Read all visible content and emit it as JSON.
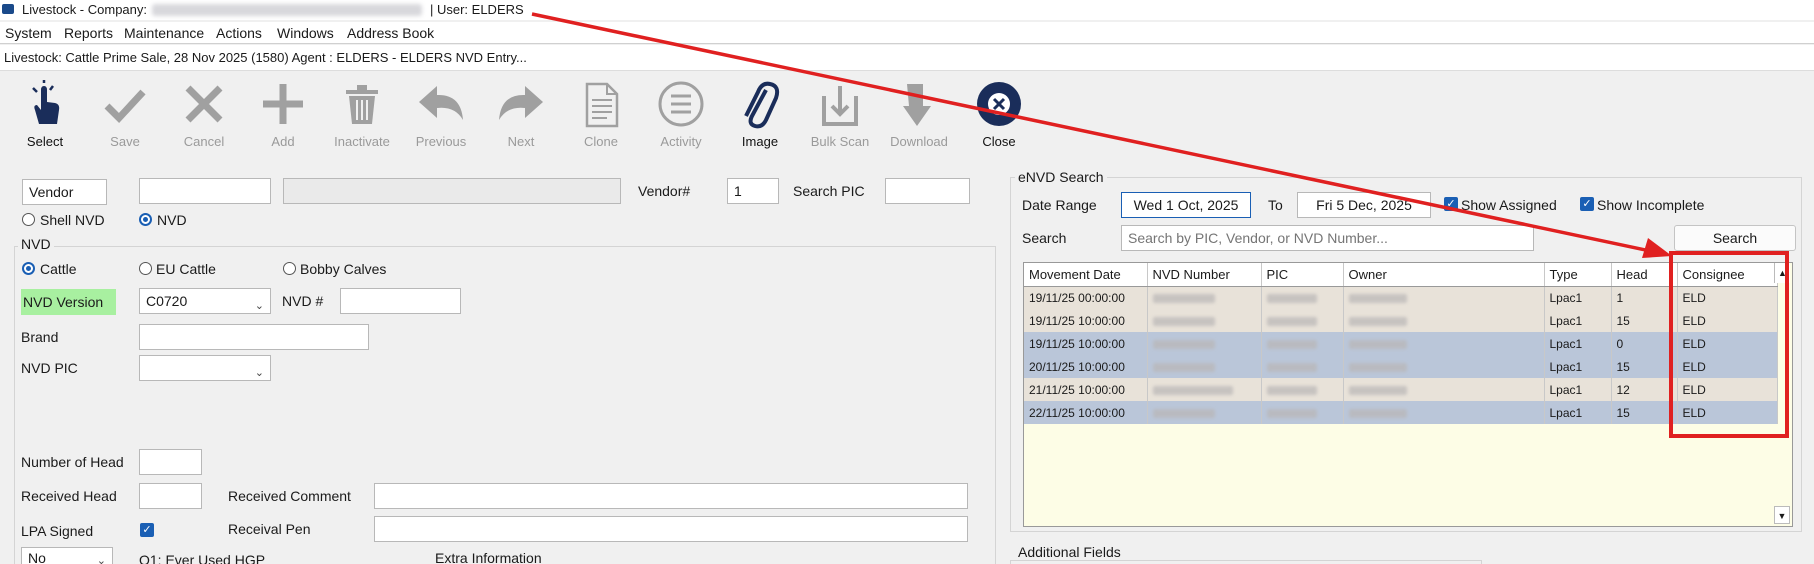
{
  "titlebar": {
    "app": "Livestock - Company:",
    "user": "| User: ELDERS"
  },
  "menu": [
    "System",
    "Reports",
    "Maintenance",
    "Actions",
    "Windows",
    "Address Book"
  ],
  "window_title": "Livestock: Cattle Prime Sale, 28 Nov 2025 (1580) Agent : ELDERS - ELDERS NVD Entry...",
  "toolbar": [
    {
      "label": "Select",
      "icon": "hand-pointer-icon",
      "enabled": true
    },
    {
      "label": "Save",
      "icon": "checkmark-icon",
      "enabled": false
    },
    {
      "label": "Cancel",
      "icon": "x-icon",
      "enabled": false
    },
    {
      "label": "Add",
      "icon": "plus-icon",
      "enabled": false
    },
    {
      "label": "Inactivate",
      "icon": "trash-icon",
      "enabled": false
    },
    {
      "label": "Previous",
      "icon": "arrow-left-icon",
      "enabled": false
    },
    {
      "label": "Next",
      "icon": "arrow-right-icon",
      "enabled": false
    },
    {
      "label": "Clone",
      "icon": "document-icon",
      "enabled": false
    },
    {
      "label": "Activity",
      "icon": "list-circle-icon",
      "enabled": false
    },
    {
      "label": "Image",
      "icon": "paperclip-icon",
      "enabled": true
    },
    {
      "label": "Bulk Scan",
      "icon": "scan-upload-icon",
      "enabled": false
    },
    {
      "label": "Download",
      "icon": "download-arrow-icon",
      "enabled": false
    },
    {
      "label": "Close",
      "icon": "close-circle-icon",
      "enabled": true
    }
  ],
  "form": {
    "vendor_label": "Vendor",
    "vendor_no_label": "Vendor#",
    "vendor_no_value": "1",
    "search_pic_label": "Search PIC",
    "shell_nvd_label": "Shell NVD",
    "nvd_radio_label": "NVD",
    "nvd_group_title": "NVD",
    "cattle_label": "Cattle",
    "eu_cattle_label": "EU Cattle",
    "bobby_calves_label": "Bobby Calves",
    "nvd_version_label": "NVD Version",
    "nvd_version_value": "C0720",
    "nvd_no_label": "NVD #",
    "brand_label": "Brand",
    "nvd_pic_label": "NVD PIC",
    "number_of_head_label": "Number of Head",
    "received_head_label": "Received Head",
    "received_comment_label": "Received Comment",
    "lpa_signed_label": "LPA Signed",
    "received_pen_label": "Receival Pen",
    "q1_value": "No",
    "q1_label": "Q1: Ever Used HGP",
    "extra_info_label": "Extra Information"
  },
  "envd": {
    "title": "eNVD Search",
    "date_range_label": "Date Range",
    "date_from": "Wed 1 Oct, 2025",
    "to_label": "To",
    "date_to": "Fri 5 Dec, 2025",
    "show_assigned": "Show Assigned",
    "show_incomplete": "Show Incomplete",
    "search_label": "Search",
    "search_placeholder": "Search by PIC, Vendor, or NVD Number...",
    "search_button": "Search",
    "columns": [
      "Movement Date",
      "NVD Number",
      "PIC",
      "Owner",
      "Type",
      "Head",
      "Consignee"
    ],
    "rows": [
      {
        "date": "19/11/25 00:00:00",
        "type": "Lpac1",
        "head": "1",
        "consignee": "ELD",
        "style": "beige"
      },
      {
        "date": "19/11/25 10:00:00",
        "type": "Lpac1",
        "head": "15",
        "consignee": "ELD",
        "style": "beige"
      },
      {
        "date": "19/11/25 10:00:00",
        "type": "Lpac1",
        "head": "0",
        "consignee": "ELD",
        "style": "blue"
      },
      {
        "date": "20/11/25 10:00:00",
        "type": "Lpac1",
        "head": "15",
        "consignee": "ELD",
        "style": "blue"
      },
      {
        "date": "21/11/25 10:00:00",
        "type": "Lpac1",
        "head": "12",
        "consignee": "ELD",
        "style": "beige"
      },
      {
        "date": "22/11/25 10:00:00",
        "type": "Lpac1",
        "head": "15",
        "consignee": "ELD",
        "style": "blue"
      }
    ],
    "additional_fields": "Additional Fields"
  },
  "colors": {
    "annotation": "#e02020",
    "accent": "#1a5fb4",
    "nvd_version_bg": "#a8f0a0"
  }
}
